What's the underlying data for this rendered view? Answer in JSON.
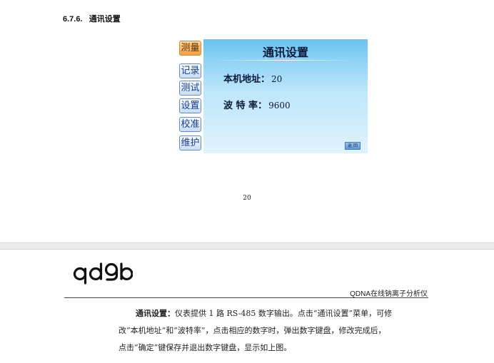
{
  "page1": {
    "section_title": "6.7.6.   通讯设置",
    "screen": {
      "side_buttons": [
        "测量",
        "记录",
        "测试",
        "设置",
        "校准",
        "维护"
      ],
      "title": "通讯设置",
      "address_label": "本机地址：",
      "address_value": "20",
      "baud_label": "波 特 率：",
      "baud_value": "9600",
      "back_label": "返 回"
    },
    "page_number": "20"
  },
  "page2": {
    "logo": "qd9b",
    "brand": "QDNA在线钠离子分析仪",
    "para_bold": "通讯设置：",
    "para_line1": "仪表提供 1 路 RS-485 数字输出。点击“通讯设置”菜单，可修",
    "para_line2": "改“本机地址”和“波特率”，点击相应的数字时，弹出数字键盘，修改完成后，",
    "para_line3": "点击“确定”键保存并退出数字键盘，显示如上图。"
  }
}
